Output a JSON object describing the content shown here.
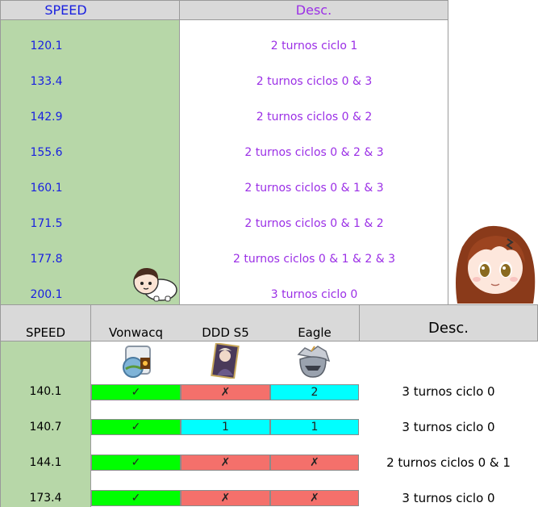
{
  "top_table": {
    "headers": {
      "speed": "SPEED",
      "desc": "Desc."
    },
    "rows": [
      {
        "speed": "120.1",
        "desc": "2 turnos ciclo 1"
      },
      {
        "speed": "133.4",
        "desc": "2 turnos ciclos 0 & 3"
      },
      {
        "speed": "142.9",
        "desc": "2 turnos ciclos 0 & 2"
      },
      {
        "speed": "155.6",
        "desc": "2 turnos ciclos 0 & 2 & 3"
      },
      {
        "speed": "160.1",
        "desc": "2 turnos ciclos 0 & 1 & 3"
      },
      {
        "speed": "171.5",
        "desc": "2 turnos ciclos 0 & 1 & 2"
      },
      {
        "speed": "177.8",
        "desc": "2 turnos ciclos 0 & 1 & 2 & 3"
      },
      {
        "speed": "200.1",
        "desc": "3 turnos ciclo 0"
      }
    ]
  },
  "bottom_table": {
    "headers": {
      "speed": "SPEED",
      "col1": "Vonwacq",
      "col2": "DDD S5",
      "col3": "Eagle",
      "desc": "Desc."
    },
    "rows": [
      {
        "speed": "140.1",
        "col1": "✓",
        "col2": "✗",
        "col3": "2",
        "desc": "3 turnos ciclo 0",
        "col1_color": "#00ff00",
        "col2_color": "#f4706b",
        "col3_color": "#00ffff"
      },
      {
        "speed": "140.7",
        "col1": "✓",
        "col2": "1",
        "col3": "1",
        "desc": "3 turnos ciclo 0",
        "col1_color": "#00ff00",
        "col2_color": "#00ffff",
        "col3_color": "#00ffff"
      },
      {
        "speed": "144.1",
        "col1": "✓",
        "col2": "✗",
        "col3": "✗",
        "desc": "2 turnos ciclos 0 & 1",
        "col1_color": "#00ff00",
        "col2_color": "#f4706b",
        "col3_color": "#f4706b"
      },
      {
        "speed": "173.4",
        "col1": "✓",
        "col2": "✗",
        "col3": "✗",
        "desc": "3 turnos ciclo 0",
        "col1_color": "#00ff00",
        "col2_color": "#f4706b",
        "col3_color": "#f4706b"
      }
    ],
    "icons": [
      "vonwacq-relic-icon",
      "ddd-card-icon",
      "eagle-helmet-icon"
    ]
  },
  "colors": {
    "header_bg": "#d9d9d9",
    "speed_col_bg": "#b7d7a8",
    "speed_text": "#1a21e0",
    "desc_text": "#9b2fe6",
    "check_green": "#00ff00",
    "cross_red": "#f4706b",
    "count_cyan": "#00ffff"
  }
}
